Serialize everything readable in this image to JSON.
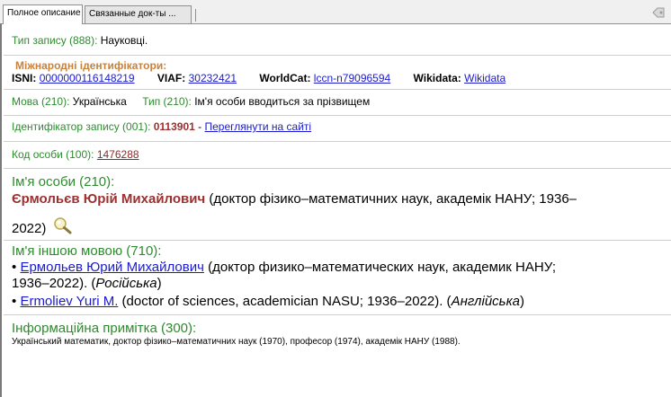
{
  "tabs": {
    "full": "Полное описание",
    "linked": "Связанные док-ты ..."
  },
  "record_type": {
    "label": "Тип запису (888):",
    "value": "Науковці."
  },
  "identifiers": {
    "heading": "Міжнародні ідентифікатори:",
    "isni_label": "ISNI:",
    "isni_value": "0000000116148219",
    "viaf_label": "VIAF:",
    "viaf_value": "30232421",
    "worldcat_label": "WorldCat:",
    "worldcat_value": "lccn-n79096594",
    "wikidata_label": "Wikidata:",
    "wikidata_value": "Wikidata"
  },
  "language": {
    "label": "Мова (210):",
    "value": "Українська",
    "type_label": "Тип (210):",
    "type_value": "Ім'я особи вводиться за прізвищем"
  },
  "record_id": {
    "label": "Ідентифікатор запису (001):",
    "value": "0113901",
    "dash": "-",
    "link": "Переглянути на сайті"
  },
  "person_code": {
    "label": "Код особи (100):",
    "value": "1476288"
  },
  "person_name": {
    "label": "Ім'я особи (210):",
    "name": "Єрмольєв Юрій Михайлович",
    "details_line1": "(доктор фізико–математичних наук, академік НАНУ; 1936–",
    "details_line2": "2022)"
  },
  "other_language": {
    "label": "Ім'я іншою мовою (710):",
    "items": [
      {
        "name": "Ермольев Юрий Михайлович",
        "details_line1": "(доктор физико–математических наук, академик НАНУ;",
        "details_line2": "1936–2022). (",
        "lang": "Російська",
        "close": ")"
      },
      {
        "name": "Ermoliev Yuri M.",
        "details_line1": "(doctor of sciences, academician NASU; 1936–2022). (",
        "lang": "Англійська",
        "close": ")"
      }
    ]
  },
  "info_note": {
    "label": "Інформаційна примітка (300):",
    "text": "Український математик, доктор фізико–математичних наук (1970), професор (1974), академік НАНУ (1988)."
  }
}
